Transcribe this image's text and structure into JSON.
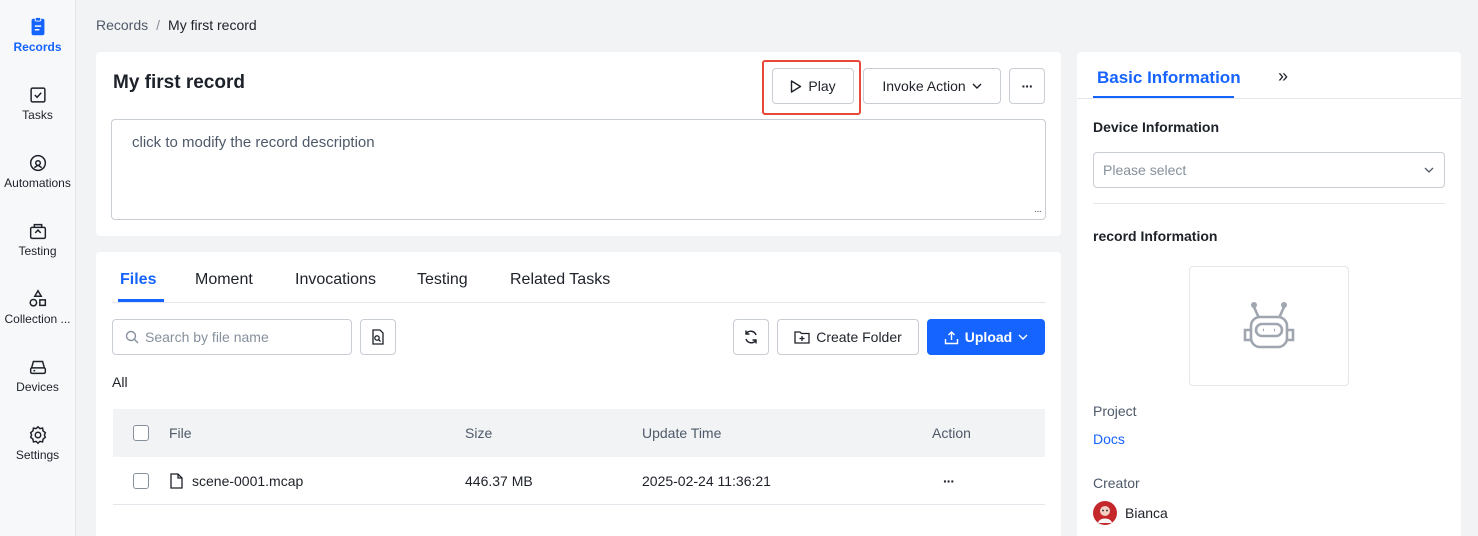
{
  "sidebar": {
    "items": [
      {
        "label": "Records",
        "icon": "records-icon",
        "active": true
      },
      {
        "label": "Tasks",
        "icon": "tasks-icon"
      },
      {
        "label": "Automations",
        "icon": "automations-icon"
      },
      {
        "label": "Testing",
        "icon": "testing-icon"
      },
      {
        "label": "Collection ...",
        "icon": "collection-icon"
      },
      {
        "label": "Devices",
        "icon": "devices-icon"
      },
      {
        "label": "Settings",
        "icon": "gear-icon"
      }
    ]
  },
  "breadcrumb": {
    "parent": "Records",
    "separator": "/",
    "current": "My first record"
  },
  "record": {
    "title": "My first record",
    "play_label": "Play",
    "invoke_label": "Invoke Action",
    "more_label": "···",
    "description_placeholder": "click to modify the record description"
  },
  "files": {
    "tabs": [
      "Files",
      "Moment",
      "Invocations",
      "Testing",
      "Related Tasks"
    ],
    "search_placeholder": "Search by file name",
    "create_folder_label": "Create Folder",
    "upload_label": "Upload",
    "filter_label": "All",
    "columns": {
      "file": "File",
      "size": "Size",
      "update_time": "Update Time",
      "action": "Action"
    },
    "rows": [
      {
        "name": "scene-0001.mcap",
        "size": "446.37 MB",
        "update_time": "2025-02-24 11:36:21",
        "action": "···"
      }
    ]
  },
  "panel": {
    "tab_label": "Basic Information",
    "expand_label": "»",
    "device_heading": "Device Information",
    "device_placeholder": "Please select",
    "record_heading": "record Information",
    "project_label": "Project",
    "project_value": "Docs",
    "creator_label": "Creator",
    "creator_name": "Bianca"
  },
  "colors": {
    "accent": "#1664ff",
    "highlight": "#e8483a"
  }
}
